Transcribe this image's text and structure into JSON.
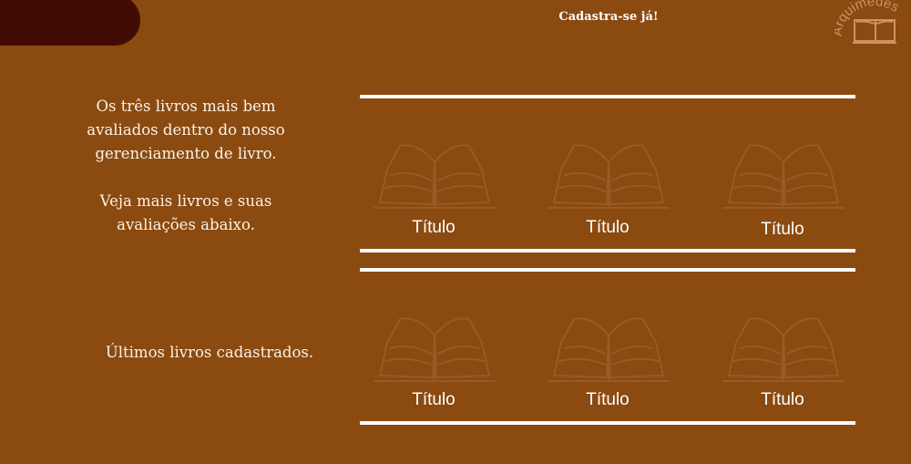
{
  "header": {
    "cta_label": "Cadastra-se já!",
    "logo_text": "Arquimedes",
    "logo_icon": "open-book-icon"
  },
  "intro": {
    "line1": "Os três livros mais bem avaliados dentro do nosso gerenciamento de livro.",
    "line2": "Veja mais livros e suas avaliações abaixo."
  },
  "top_books": [
    {
      "title": "Título",
      "icon": "open-book-icon"
    },
    {
      "title": "Título",
      "icon": "open-book-icon"
    },
    {
      "title": "Título",
      "icon": "open-book-icon"
    }
  ],
  "latest": {
    "heading": "Últimos livros cadastrados.",
    "books": [
      {
        "title": "Título",
        "icon": "open-book-icon"
      },
      {
        "title": "Título",
        "icon": "open-book-icon"
      },
      {
        "title": "Título",
        "icon": "open-book-icon"
      }
    ]
  },
  "colors": {
    "background": "#8b4a10",
    "accent_dark": "#420c05",
    "line": "#ffffff",
    "book_icon": "#9a5a26"
  }
}
